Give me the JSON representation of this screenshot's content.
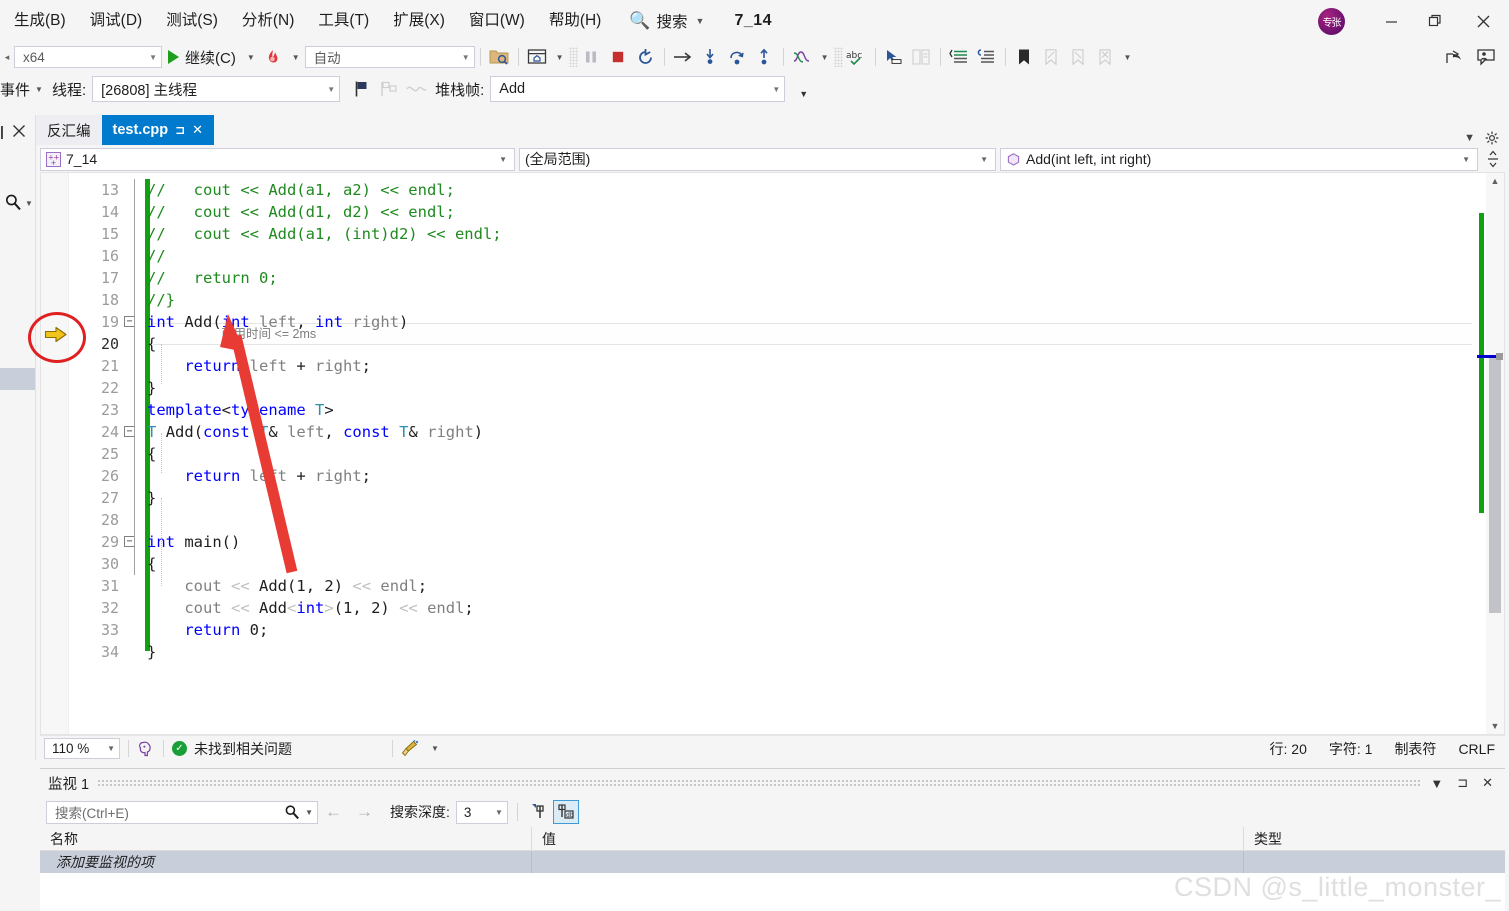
{
  "menu": {
    "items": [
      {
        "label": "生成(B)",
        "key": "B"
      },
      {
        "label": "调试(D)",
        "key": "D"
      },
      {
        "label": "测试(S)",
        "key": "S"
      },
      {
        "label": "分析(N)",
        "key": "N"
      },
      {
        "label": "工具(T)",
        "key": "T"
      },
      {
        "label": "扩展(X)",
        "key": "X"
      },
      {
        "label": "窗口(W)",
        "key": "W"
      },
      {
        "label": "帮助(H)",
        "key": "H"
      }
    ],
    "search_placeholder": "搜索",
    "project_name": "7_14",
    "avatar_text": "专张"
  },
  "window_controls": {
    "minimize": "—",
    "maximize": "❐",
    "close": "✕"
  },
  "toolbar": {
    "platform": "x64",
    "run_label": "继续(C)",
    "config": "自动",
    "icons": [
      "open-file-icon",
      "web-browser-icon",
      "pause-icon",
      "stop-icon",
      "restart-icon",
      "step-over-icon",
      "step-into-icon",
      "step-out-icon-curve",
      "step-up-icon",
      "threads-icon",
      "spell-check-icon",
      "select-tool-icon",
      "compare-icon",
      "comment-icon",
      "uncomment-icon",
      "bookmark-icon",
      "bookmark-prev-icon",
      "bookmark-next-icon",
      "bookmark-clear-icon"
    ],
    "share_icon": "share-icon",
    "feedback_icon": "feedback-icon"
  },
  "debug_toolbar": {
    "events_label": "事件",
    "thread_label": "线程:",
    "thread_value": "[26808] 主线程",
    "stackframe_label": "堆栈帧:",
    "stackframe_value": "Add"
  },
  "left_dock": {
    "close_icon": "close-icon",
    "search_icon": "search-icon"
  },
  "tabs": [
    {
      "label": "反汇编",
      "active": false
    },
    {
      "label": "test.cpp",
      "active": true,
      "pin": "⊐",
      "close": "✕"
    }
  ],
  "navbar": {
    "project": "7_14",
    "scope": "(全局范围)",
    "member": "Add(int left, int right)"
  },
  "editor": {
    "current_line": 20,
    "datatip": "已用时间 <= 2ms",
    "lines": [
      {
        "n": 13,
        "indent": 1,
        "tokens": [
          {
            "t": "//   cout << Add(a1, a2) << endl;",
            "c": "c-com"
          }
        ]
      },
      {
        "n": 14,
        "indent": 1,
        "tokens": [
          {
            "t": "//   cout << Add(d1, d2) << endl;",
            "c": "c-com"
          }
        ]
      },
      {
        "n": 15,
        "indent": 1,
        "tokens": [
          {
            "t": "//   cout << Add(a1, (int)d2) << endl;",
            "c": "c-com"
          }
        ]
      },
      {
        "n": 16,
        "indent": 1,
        "tokens": [
          {
            "t": "//",
            "c": "c-com"
          }
        ]
      },
      {
        "n": 17,
        "indent": 1,
        "tokens": [
          {
            "t": "//   return 0;",
            "c": "c-com"
          }
        ]
      },
      {
        "n": 18,
        "indent": 1,
        "tokens": [
          {
            "t": "//}",
            "c": "c-com"
          }
        ]
      },
      {
        "n": 19,
        "indent": 1,
        "fold": true,
        "tokens": [
          {
            "t": "int",
            "c": "c-kw"
          },
          {
            "t": " ",
            "c": "c-op"
          },
          {
            "t": "Add",
            "c": "c-id"
          },
          {
            "t": "(",
            "c": "c-op"
          },
          {
            "t": "int",
            "c": "c-kw"
          },
          {
            "t": " ",
            "c": "c-op"
          },
          {
            "t": "left",
            "c": "c-var"
          },
          {
            "t": ", ",
            "c": "c-op"
          },
          {
            "t": "int",
            "c": "c-kw"
          },
          {
            "t": " ",
            "c": "c-op"
          },
          {
            "t": "right",
            "c": "c-var"
          },
          {
            "t": ")",
            "c": "c-op"
          }
        ]
      },
      {
        "n": 20,
        "indent": 1,
        "tokens": [
          {
            "t": "{",
            "c": "c-op"
          }
        ]
      },
      {
        "n": 21,
        "indent": 2,
        "tokens": [
          {
            "t": "return",
            "c": "c-kw"
          },
          {
            "t": " ",
            "c": "c-op"
          },
          {
            "t": "left",
            "c": "c-var"
          },
          {
            "t": " + ",
            "c": "c-op"
          },
          {
            "t": "right",
            "c": "c-var"
          },
          {
            "t": ";",
            "c": "c-op"
          }
        ]
      },
      {
        "n": 22,
        "indent": 1,
        "tokens": [
          {
            "t": "}",
            "c": "c-op"
          }
        ]
      },
      {
        "n": 23,
        "indent": 1,
        "tokens": [
          {
            "t": "template",
            "c": "c-kw"
          },
          {
            "t": "<",
            "c": "c-op"
          },
          {
            "t": "typename",
            "c": "c-kw"
          },
          {
            "t": " ",
            "c": "c-op"
          },
          {
            "t": "T",
            "c": "c-typ"
          },
          {
            "t": ">",
            "c": "c-op"
          }
        ]
      },
      {
        "n": 24,
        "indent": 1,
        "fold": true,
        "tokens": [
          {
            "t": "T",
            "c": "c-typ"
          },
          {
            "t": " ",
            "c": "c-op"
          },
          {
            "t": "Add",
            "c": "c-id"
          },
          {
            "t": "(",
            "c": "c-op"
          },
          {
            "t": "const",
            "c": "c-kw"
          },
          {
            "t": " ",
            "c": "c-op"
          },
          {
            "t": "T",
            "c": "c-typ"
          },
          {
            "t": "&",
            "c": "c-op"
          },
          {
            "t": " ",
            "c": "c-op"
          },
          {
            "t": "left",
            "c": "c-var"
          },
          {
            "t": ", ",
            "c": "c-op"
          },
          {
            "t": "const",
            "c": "c-kw"
          },
          {
            "t": " ",
            "c": "c-op"
          },
          {
            "t": "T",
            "c": "c-typ"
          },
          {
            "t": "&",
            "c": "c-op"
          },
          {
            "t": " ",
            "c": "c-op"
          },
          {
            "t": "right",
            "c": "c-var"
          },
          {
            "t": ")",
            "c": "c-op"
          }
        ]
      },
      {
        "n": 25,
        "indent": 1,
        "tokens": [
          {
            "t": "{",
            "c": "c-op"
          }
        ]
      },
      {
        "n": 26,
        "indent": 2,
        "tokens": [
          {
            "t": "return",
            "c": "c-kw"
          },
          {
            "t": " ",
            "c": "c-op"
          },
          {
            "t": "left",
            "c": "c-var"
          },
          {
            "t": " + ",
            "c": "c-op"
          },
          {
            "t": "right",
            "c": "c-var"
          },
          {
            "t": ";",
            "c": "c-op"
          }
        ]
      },
      {
        "n": 27,
        "indent": 1,
        "tokens": [
          {
            "t": "}",
            "c": "c-op"
          }
        ]
      },
      {
        "n": 28,
        "indent": 1,
        "tokens": []
      },
      {
        "n": 29,
        "indent": 1,
        "fold": true,
        "tokens": [
          {
            "t": "int",
            "c": "c-kw"
          },
          {
            "t": " ",
            "c": "c-op"
          },
          {
            "t": "main",
            "c": "c-id"
          },
          {
            "t": "()",
            "c": "c-op"
          }
        ]
      },
      {
        "n": 30,
        "indent": 1,
        "tokens": [
          {
            "t": "{",
            "c": "c-op"
          }
        ]
      },
      {
        "n": 31,
        "indent": 2,
        "tokens": [
          {
            "t": "cout",
            "c": "c-var"
          },
          {
            "t": " ",
            "c": "c-op"
          },
          {
            "t": "<<",
            "c": "c-stream"
          },
          {
            "t": " ",
            "c": "c-op"
          },
          {
            "t": "Add",
            "c": "c-id"
          },
          {
            "t": "(",
            "c": "c-op"
          },
          {
            "t": "1",
            "c": "c-num"
          },
          {
            "t": ", ",
            "c": "c-op"
          },
          {
            "t": "2",
            "c": "c-num"
          },
          {
            "t": ") ",
            "c": "c-op"
          },
          {
            "t": "<<",
            "c": "c-stream"
          },
          {
            "t": " ",
            "c": "c-op"
          },
          {
            "t": "endl",
            "c": "c-var"
          },
          {
            "t": ";",
            "c": "c-op"
          }
        ]
      },
      {
        "n": 32,
        "indent": 2,
        "tokens": [
          {
            "t": "cout",
            "c": "c-var"
          },
          {
            "t": " ",
            "c": "c-op"
          },
          {
            "t": "<<",
            "c": "c-stream"
          },
          {
            "t": " ",
            "c": "c-op"
          },
          {
            "t": "Add",
            "c": "c-id"
          },
          {
            "t": "<",
            "c": "c-stream"
          },
          {
            "t": "int",
            "c": "c-kw"
          },
          {
            "t": ">",
            "c": "c-stream"
          },
          {
            "t": "(",
            "c": "c-op"
          },
          {
            "t": "1",
            "c": "c-num"
          },
          {
            "t": ", ",
            "c": "c-op"
          },
          {
            "t": "2",
            "c": "c-num"
          },
          {
            "t": ") ",
            "c": "c-op"
          },
          {
            "t": "<<",
            "c": "c-stream"
          },
          {
            "t": " ",
            "c": "c-op"
          },
          {
            "t": "endl",
            "c": "c-var"
          },
          {
            "t": ";",
            "c": "c-op"
          }
        ]
      },
      {
        "n": 33,
        "indent": 2,
        "tokens": [
          {
            "t": "return",
            "c": "c-kw"
          },
          {
            "t": " ",
            "c": "c-op"
          },
          {
            "t": "0",
            "c": "c-num"
          },
          {
            "t": ";",
            "c": "c-op"
          }
        ]
      },
      {
        "n": 34,
        "indent": 1,
        "tokens": [
          {
            "t": "}",
            "c": "c-op"
          }
        ]
      }
    ]
  },
  "editor_status": {
    "zoom": "110 %",
    "intellisense_icon": "intellisense-icon",
    "issues": "未找到相关问题",
    "cleanup_icon": "code-cleanup-icon",
    "line": "行: 20",
    "column": "字符: 1",
    "tabs_mode": "制表符",
    "eol": "CRLF"
  },
  "watch": {
    "title": "监视 1",
    "search_placeholder": "搜索(Ctrl+E)",
    "depth_label": "搜索深度:",
    "depth_value": "3",
    "columns": [
      "名称",
      "值",
      "类型"
    ],
    "rows": [
      {
        "name": "添加要监视的项",
        "value": "",
        "type": ""
      }
    ],
    "header_buttons": {
      "dropdown": "▼",
      "pin": "⊐",
      "close": "✕"
    },
    "back_arrow": "←",
    "forward_arrow": "→"
  },
  "watermark": "CSDN @s_little_monster_",
  "colors": {
    "accent_blue": "#007acc",
    "green_change_bar": "#11a111",
    "exec_arrow": "#e8b10a",
    "annotation_red": "#e02020",
    "selection_gray": "#c9cedb"
  }
}
